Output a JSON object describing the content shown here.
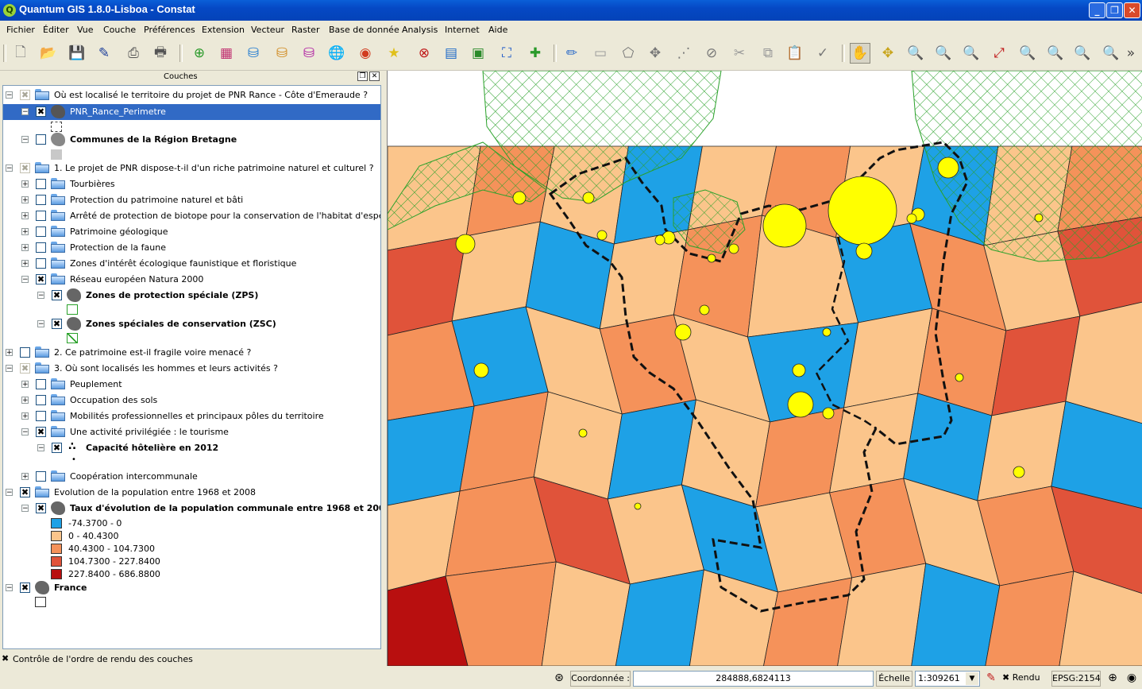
{
  "window": {
    "title": "Quantum GIS 1.8.0-Lisboa - Constat"
  },
  "menu": [
    "Fichier",
    "Éditer",
    "Vue",
    "Couche",
    "Préférences",
    "Extension",
    "Vecteur",
    "Raster",
    "Base de donnée",
    "Analysis",
    "Internet",
    "Aide"
  ],
  "panel": {
    "title": "Couches"
  },
  "layers": {
    "g1": "Où est localisé le territoire du projet de PNR Rance - Côte d'Emeraude ?",
    "pnr": "PNR_Rance_Perimetre",
    "communes": "Communes de la Région Bretagne",
    "g2": "1. Le projet de PNR dispose-t-il d'un riche patrimoine naturel et culturel ?",
    "tourb": "Tourbières",
    "protpat": "Protection du patrimoine naturel et bâti",
    "arrete": "Arrêté de protection de biotope pour la conservation de l'habitat d'espèces pr...",
    "geol": "Patrimoine géologique",
    "faune": "Protection de la faune",
    "znieff": "Zones d'intérêt écologique faunistique et floristique",
    "natura": "Réseau européen Natura 2000",
    "zps": "Zones de protection spéciale (ZPS)",
    "zsc": "Zones spéciales de conservation (ZSC)",
    "g3": "2. Ce patrimoine est-il fragile voire menacé ?",
    "g4": "3. Où sont localisés les hommes et leurs activités ?",
    "peup": "Peuplement",
    "occ": "Occupation des sols",
    "mob": "Mobilités professionnelles et principaux pôles du territoire",
    "tour": "Une activité privilégiée : le tourisme",
    "capa": "Capacité hôtelière en 2012",
    "coop": "Coopération intercommunale",
    "evo": "Evolution de la population entre 1968 et 2008",
    "taux": "Taux d'évolution de la population communale entre 1968 et 2008",
    "classes": [
      "-74.3700 - 0",
      "0 - 40.4300",
      "40.4300 - 104.7300",
      "104.7300 - 227.8400",
      "227.8400 - 686.8800"
    ],
    "france": "France"
  },
  "colors": {
    "c0": "#1ea1e6",
    "c1": "#fbc58b",
    "c2": "#f5925a",
    "c3": "#e0533a",
    "c4": "#b80f0f",
    "natura": "#2aa12a",
    "hotel": "#ffff00"
  },
  "order_label": "Contrôle de l'ordre de rendu des couches",
  "status": {
    "coord_label": "Coordonnée :",
    "coord_value": "284888,6824113",
    "scale_label": "Échelle",
    "scale_value": "1:309261",
    "render_label": "Rendu",
    "crs": "EPSG:2154"
  },
  "map": {
    "communes": [
      {
        "name": "c01",
        "cls": 1
      },
      {
        "name": "c02",
        "cls": 2
      },
      {
        "name": "c03",
        "cls": 1
      },
      {
        "name": "c04",
        "cls": 0
      },
      {
        "name": "c05",
        "cls": 1
      },
      {
        "name": "c06",
        "cls": 2
      },
      {
        "name": "c07",
        "cls": 1
      },
      {
        "name": "c08",
        "cls": 0
      },
      {
        "name": "c09",
        "cls": 1
      },
      {
        "name": "c10",
        "cls": 2
      },
      {
        "name": "c11",
        "cls": 3
      },
      {
        "name": "c12",
        "cls": 1
      },
      {
        "name": "c13",
        "cls": 0
      },
      {
        "name": "c14",
        "cls": 1
      },
      {
        "name": "c15",
        "cls": 2
      },
      {
        "name": "c16",
        "cls": 1
      },
      {
        "name": "c17",
        "cls": 0
      },
      {
        "name": "c18",
        "cls": 2
      },
      {
        "name": "c19",
        "cls": 1
      },
      {
        "name": "c20",
        "cls": 3
      },
      {
        "name": "c21",
        "cls": 2
      },
      {
        "name": "c22",
        "cls": 0
      },
      {
        "name": "c23",
        "cls": 1
      },
      {
        "name": "c24",
        "cls": 2
      },
      {
        "name": "c25",
        "cls": 1
      },
      {
        "name": "c26",
        "cls": 0
      },
      {
        "name": "c27",
        "cls": 1
      },
      {
        "name": "c28",
        "cls": 2
      },
      {
        "name": "c29",
        "cls": 3
      },
      {
        "name": "c30",
        "cls": 1
      },
      {
        "name": "c31",
        "cls": 0
      },
      {
        "name": "c32",
        "cls": 2
      },
      {
        "name": "c33",
        "cls": 1
      },
      {
        "name": "c34",
        "cls": 0
      },
      {
        "name": "c35",
        "cls": 1
      },
      {
        "name": "c36",
        "cls": 2
      },
      {
        "name": "c37",
        "cls": 1
      },
      {
        "name": "c38",
        "cls": 0
      },
      {
        "name": "c39",
        "cls": 1
      },
      {
        "name": "c40",
        "cls": 0
      },
      {
        "name": "c41",
        "cls": 1
      },
      {
        "name": "c42",
        "cls": 2
      },
      {
        "name": "c43",
        "cls": 3
      },
      {
        "name": "c44",
        "cls": 1
      },
      {
        "name": "c45",
        "cls": 0
      },
      {
        "name": "c46",
        "cls": 1
      },
      {
        "name": "c47",
        "cls": 2
      },
      {
        "name": "c48",
        "cls": 1
      },
      {
        "name": "c49",
        "cls": 2
      },
      {
        "name": "c50",
        "cls": 3
      },
      {
        "name": "c51",
        "cls": 4
      },
      {
        "name": "c52",
        "cls": 2
      },
      {
        "name": "c53",
        "cls": 1
      },
      {
        "name": "c54",
        "cls": 0
      },
      {
        "name": "c55",
        "cls": 1
      },
      {
        "name": "c56",
        "cls": 2
      },
      {
        "name": "c57",
        "cls": 1
      },
      {
        "name": "c58",
        "cls": 0
      },
      {
        "name": "c59",
        "cls": 2
      },
      {
        "name": "c60",
        "cls": 1
      }
    ]
  }
}
